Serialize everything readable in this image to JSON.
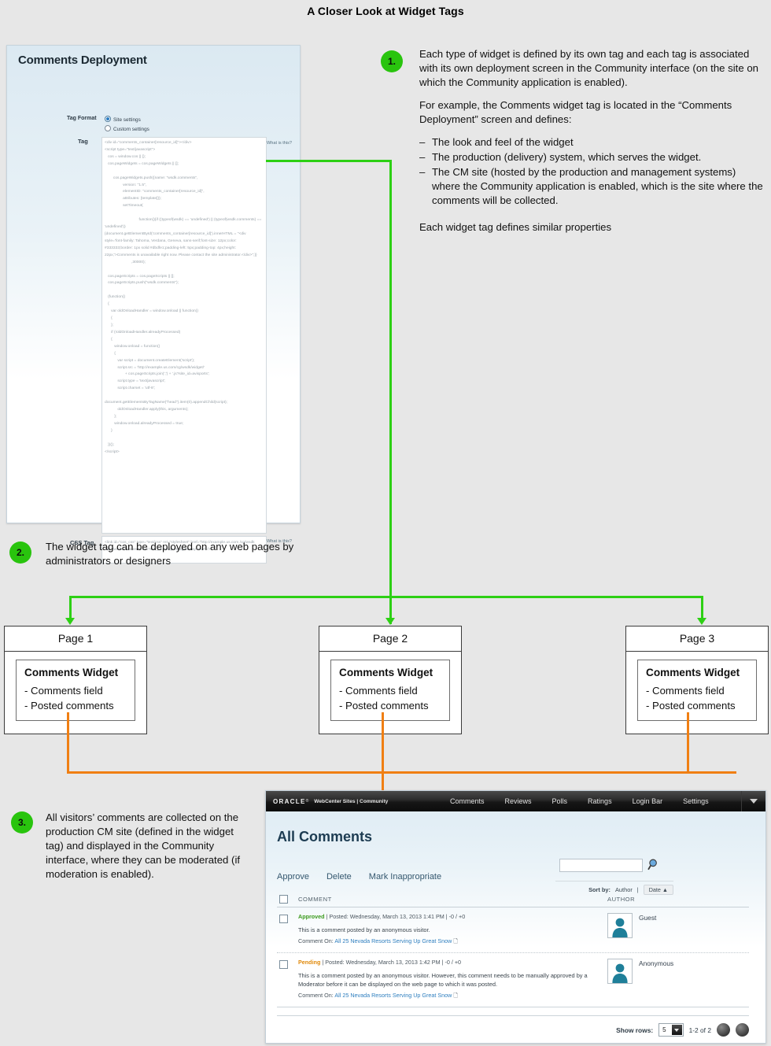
{
  "title": "A Closer Look at Widget Tags",
  "colors": {
    "green": "#29c40e",
    "orange": "#f07f13",
    "link": "#2f7fbf",
    "approved": "#3c9b1e",
    "pending": "#e08a0c"
  },
  "deployment_screen": {
    "title": "Comments Deployment",
    "tag_format_label": "Tag Format",
    "option_site": "Site settings",
    "option_custom": "Custom settings",
    "tag_label": "Tag",
    "css_tag_label": "CSS Tag",
    "what_is_this": "What is this?",
    "tag_code": "<div id=\"comments_container[resource_id]\"></div>\n<script type=\"text/javascript\">\n   cos = window.cos || {};\n   cos.pageWidgets = cos.pageWidgets || [];\n\n        cos.pageWidgets.push({name: \"wsdk.comments\",\n                 version: \"1.5\",\n                 elementID: \"comments_container[resource_id]\",\n                 attributes: [template]});\n                 setTimeout(\n\n                                function(){if ((typeof(wsdk) == 'undefined') || (typeof(wsdk.comments) == 'undefined'))\n{document.getElementById('comments_container[resource_id]').innerHTML = \"<div style='font-family: Tahoma, Verdana, Geneva, sans-serif;font-size: 12px;color: #333333;border: 1px solid #dbdfe1;padding-left: 5px;padding-top: 4px;height: 22px;'>Comments is unavailable right now. Please contact the site administrator.</div>\";}}\n                         ,30000);\n\n   cos.pageScripts = cos.pageScripts || [];\n   cos.pageScripts.push(\"wsdk.comments\");\n\n   (function()\n   {\n      var oldOnloadHandler = window.onload || function()\n      {\n      };\n      if (!oldOnloadHandler.alreadyProcessed)\n      {\n         window.onload = function()\n         {\n            var script = document.createElement('script');\n            script.src = 'http://example.us.com/cg/wsdk/widget/'\n                   + cos.pageScripts.join(';') + '.js?site_id=avisports';\n            script.type = 'text/javascript';\n            script.charset = 'utf-8';\n\ndocument.getElementsByTagName(\"head\").item(0).appendChild(script);\n            oldOnloadHandler.apply(this, arguments);\n         };\n         window.onload.alreadyProcessed = true;\n      }\n\n   })();\n</script>",
    "css_code": "<link id=\"cos_css\" type=\"text/css\" rel=\"stylesheet\" href=\"http://example.us.com /cg/wsdk\n/skin/wsdk.comments.css?site_id=avisports&gateway=true\" />"
  },
  "steps": [
    {
      "number": "1.",
      "paragraphs": [
        "Each type of widget is defined by its own tag and each tag is associated with its own deployment screen in the Community interface (on the site on which the Community application is enabled).",
        "For example, the Comments widget tag is located in the “Comments Deployment” screen and defines:"
      ],
      "bullets": [
        "The look and feel of the widget",
        "The production (delivery) system, which serves the widget.",
        "The CM site (hosted by the production and management systems) where the Community application is enabled, which is the site where the comments will be collected."
      ],
      "closing": "Each widget tag defines similar properties"
    },
    {
      "number": "2.",
      "paragraphs": [
        "The widget tag can be deployed on any web pages by administrators or designers"
      ]
    },
    {
      "number": "3.",
      "paragraphs": [
        "All visitors’ comments are collected on the production CM site (defined in the widget tag) and displayed in the Community interface, where they can be moderated (if moderation is enabled)."
      ]
    }
  ],
  "pages": [
    {
      "header": "Page 1",
      "widget_title": "Comments Widget",
      "line1": "- Comments field",
      "line2": "- Posted comments"
    },
    {
      "header": "Page 2",
      "widget_title": "Comments Widget",
      "line1": "- Comments field",
      "line2": "- Posted comments"
    },
    {
      "header": "Page 3",
      "widget_title": "Comments Widget",
      "line1": "- Comments field",
      "line2": "- Posted comments"
    }
  ],
  "community_ui": {
    "brand": "ORACLE",
    "brand_sup": "®",
    "product": "WebCenter Sites | Community",
    "nav": [
      "Comments",
      "Reviews",
      "Polls",
      "Ratings",
      "Login Bar",
      "Settings"
    ],
    "heading": "All Comments",
    "actions": [
      "Approve",
      "Delete",
      "Mark Inappropriate"
    ],
    "search_value": "",
    "search_placeholder": "",
    "sort_label": "Sort by:",
    "sort_author": "Author",
    "sort_divider": "|",
    "sort_date": "Date ▲",
    "columns": {
      "comment": "COMMENT",
      "author": "AUTHOR"
    },
    "rows": [
      {
        "status": "Approved",
        "status_type": "approved",
        "posted": "| Posted: Wednesday, March 13, 2013 1:41 PM  |  -0 / +0",
        "body": "This is a comment posted by an anonymous visitor.",
        "comment_on_label": "Comment On:",
        "comment_on_link": "All 25 Nevada Resorts Serving Up Great Snow",
        "author": "Guest"
      },
      {
        "status": "Pending",
        "status_type": "pending",
        "posted": "| Posted: Wednesday, March 13, 2013 1:42 PM  |  -0 / +0",
        "body": "This is a comment posted by an anonymous visitor. However, this comment needs to be manually approved by a Moderator before it can be displayed on the web page to which it was posted.",
        "comment_on_label": "Comment On:",
        "comment_on_link": "All 25 Nevada Resorts Serving Up Great Snow",
        "author": "Anonymous"
      }
    ],
    "footer": {
      "show_rows_label": "Show rows:",
      "rows_value": "5",
      "range": "1-2 of 2"
    }
  }
}
